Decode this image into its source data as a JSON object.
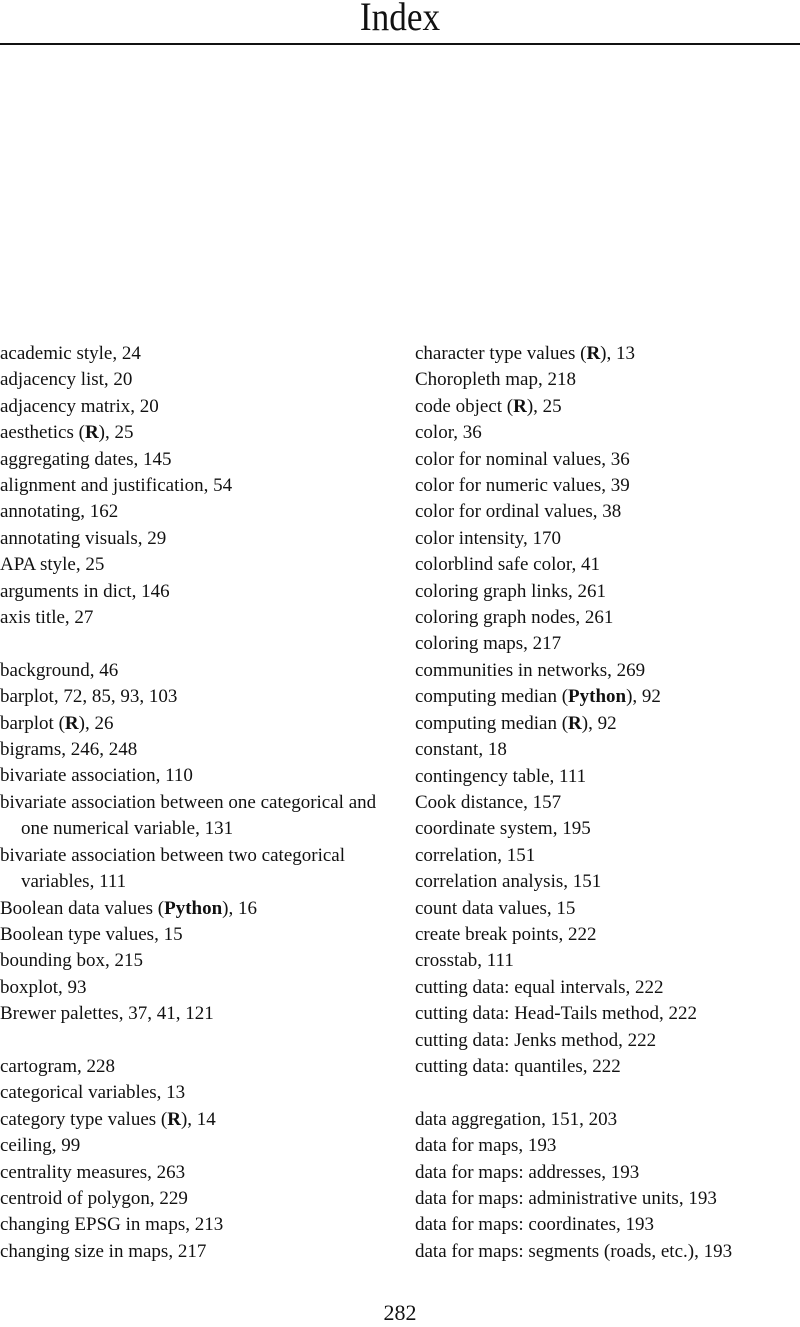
{
  "page": {
    "title": "Index",
    "page_number": "282"
  },
  "left_column": [
    {
      "pre": "academic style, 24",
      "bold": "",
      "post": ""
    },
    {
      "pre": "adjacency list, 20",
      "bold": "",
      "post": ""
    },
    {
      "pre": "adjacency matrix, 20",
      "bold": "",
      "post": ""
    },
    {
      "pre": "aesthetics (",
      "bold": "R",
      "post": "), 25"
    },
    {
      "pre": "aggregating dates, 145",
      "bold": "",
      "post": ""
    },
    {
      "pre": "alignment and justification, 54",
      "bold": "",
      "post": ""
    },
    {
      "pre": "annotating, 162",
      "bold": "",
      "post": ""
    },
    {
      "pre": "annotating visuals, 29",
      "bold": "",
      "post": ""
    },
    {
      "pre": "APA style, 25",
      "bold": "",
      "post": ""
    },
    {
      "pre": "arguments in dict, 146",
      "bold": "",
      "post": ""
    },
    {
      "pre": "axis title, 27",
      "bold": "",
      "post": ""
    },
    {
      "gap": true
    },
    {
      "pre": "background, 46",
      "bold": "",
      "post": ""
    },
    {
      "pre": "barplot, 72, 85, 93, 103",
      "bold": "",
      "post": ""
    },
    {
      "pre": "barplot (",
      "bold": "R",
      "post": "), 26"
    },
    {
      "pre": "bigrams, 246, 248",
      "bold": "",
      "post": ""
    },
    {
      "pre": "bivariate association, 110",
      "bold": "",
      "post": ""
    },
    {
      "pre": "bivariate association between one categorical and one numerical variable, 131",
      "bold": "",
      "post": "",
      "wrap": true
    },
    {
      "pre": "bivariate association between two categorical variables, 111",
      "bold": "",
      "post": "",
      "wrap": true
    },
    {
      "pre": "Boolean data values (",
      "bold": "Python",
      "post": "), 16"
    },
    {
      "pre": "Boolean type values, 15",
      "bold": "",
      "post": ""
    },
    {
      "pre": "bounding box, 215",
      "bold": "",
      "post": ""
    },
    {
      "pre": "boxplot, 93",
      "bold": "",
      "post": ""
    },
    {
      "pre": "Brewer palettes, 37, 41, 121",
      "bold": "",
      "post": ""
    },
    {
      "gap": true
    },
    {
      "pre": "cartogram, 228",
      "bold": "",
      "post": ""
    },
    {
      "pre": "categorical variables, 13",
      "bold": "",
      "post": ""
    },
    {
      "pre": "category type values (",
      "bold": "R",
      "post": "), 14"
    },
    {
      "pre": "ceiling, 99",
      "bold": "",
      "post": ""
    },
    {
      "pre": "centrality measures, 263",
      "bold": "",
      "post": ""
    },
    {
      "pre": "centroid of polygon, 229",
      "bold": "",
      "post": ""
    },
    {
      "pre": "changing EPSG in maps, 213",
      "bold": "",
      "post": ""
    },
    {
      "pre": "changing size in maps, 217",
      "bold": "",
      "post": ""
    }
  ],
  "right_column": [
    {
      "pre": "character type values (",
      "bold": "R",
      "post": "), 13"
    },
    {
      "pre": "Choropleth map, 218",
      "bold": "",
      "post": ""
    },
    {
      "pre": "code object (",
      "bold": "R",
      "post": "), 25"
    },
    {
      "pre": "color, 36",
      "bold": "",
      "post": ""
    },
    {
      "pre": "color for nominal values, 36",
      "bold": "",
      "post": ""
    },
    {
      "pre": "color for numeric values, 39",
      "bold": "",
      "post": ""
    },
    {
      "pre": "color for ordinal values, 38",
      "bold": "",
      "post": ""
    },
    {
      "pre": "color intensity, 170",
      "bold": "",
      "post": ""
    },
    {
      "pre": "colorblind safe color, 41",
      "bold": "",
      "post": ""
    },
    {
      "pre": "coloring graph links, 261",
      "bold": "",
      "post": ""
    },
    {
      "pre": "coloring graph nodes, 261",
      "bold": "",
      "post": ""
    },
    {
      "pre": "coloring maps, 217",
      "bold": "",
      "post": ""
    },
    {
      "pre": "communities in networks, 269",
      "bold": "",
      "post": ""
    },
    {
      "pre": "computing median (",
      "bold": "Python",
      "post": "), 92"
    },
    {
      "pre": "computing median (",
      "bold": "R",
      "post": "), 92"
    },
    {
      "pre": "constant, 18",
      "bold": "",
      "post": ""
    },
    {
      "pre": "contingency table, 111",
      "bold": "",
      "post": ""
    },
    {
      "pre": "Cook distance, 157",
      "bold": "",
      "post": ""
    },
    {
      "pre": "coordinate system, 195",
      "bold": "",
      "post": ""
    },
    {
      "pre": "correlation, 151",
      "bold": "",
      "post": ""
    },
    {
      "pre": "correlation analysis, 151",
      "bold": "",
      "post": ""
    },
    {
      "pre": "count data values, 15",
      "bold": "",
      "post": ""
    },
    {
      "pre": "create break points, 222",
      "bold": "",
      "post": ""
    },
    {
      "pre": "crosstab, 111",
      "bold": "",
      "post": ""
    },
    {
      "pre": "cutting data: equal intervals, 222",
      "bold": "",
      "post": ""
    },
    {
      "pre": "cutting data: Head-Tails method, 222",
      "bold": "",
      "post": ""
    },
    {
      "pre": "cutting data: Jenks method, 222",
      "bold": "",
      "post": ""
    },
    {
      "pre": "cutting data: quantiles, 222",
      "bold": "",
      "post": ""
    },
    {
      "gap": true
    },
    {
      "pre": "data aggregation, 151, 203",
      "bold": "",
      "post": ""
    },
    {
      "pre": "data for maps, 193",
      "bold": "",
      "post": ""
    },
    {
      "pre": "data for maps: addresses, 193",
      "bold": "",
      "post": ""
    },
    {
      "pre": "data for maps: administrative units, 193",
      "bold": "",
      "post": ""
    },
    {
      "pre": "data for maps: coordinates, 193",
      "bold": "",
      "post": ""
    },
    {
      "pre": "data for maps: segments (roads, etc.), 193",
      "bold": "",
      "post": ""
    }
  ]
}
